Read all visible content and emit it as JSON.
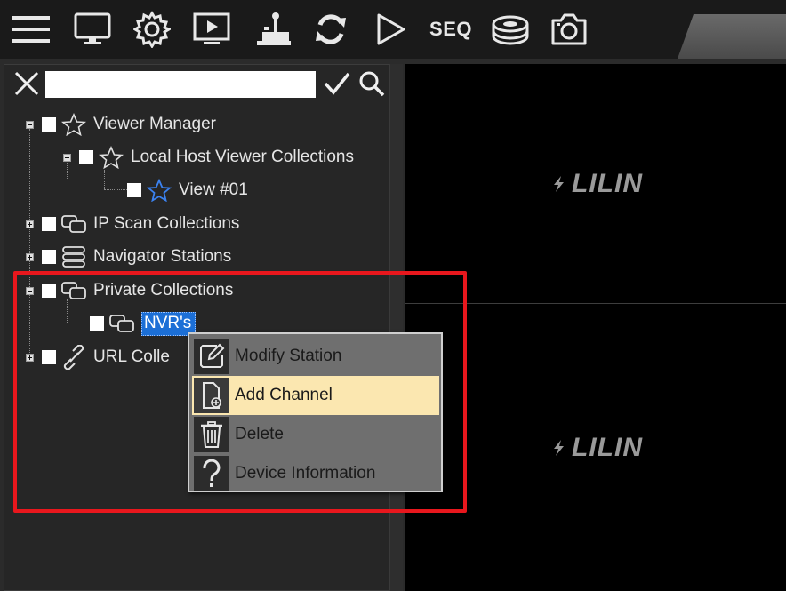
{
  "toolbar": {
    "buttons": [
      {
        "id": "menu",
        "icon": "hamburger-menu-icon"
      },
      {
        "id": "monitor",
        "icon": "monitor-icon"
      },
      {
        "id": "settings",
        "icon": "gear-icon"
      },
      {
        "id": "playback",
        "icon": "playback-screen-icon"
      },
      {
        "id": "joystick",
        "icon": "joystick-icon"
      },
      {
        "id": "refresh",
        "icon": "refresh-icon"
      },
      {
        "id": "play",
        "icon": "play-icon"
      },
      {
        "id": "seq",
        "label": "SEQ"
      },
      {
        "id": "storage",
        "icon": "disk-stack-icon"
      },
      {
        "id": "snapshot",
        "icon": "camera-icon"
      }
    ]
  },
  "search": {
    "value": "",
    "placeholder": ""
  },
  "tree": {
    "items": [
      {
        "label": "Viewer Manager",
        "icon": "star-icon",
        "expander": "minus"
      },
      {
        "label": "Local Host Viewer Collections",
        "icon": "star-icon",
        "expander": "minus"
      },
      {
        "label": "View #01",
        "icon": "star-blue-icon"
      },
      {
        "label": "IP Scan Collections",
        "icon": "collection-icon",
        "expander": "plus"
      },
      {
        "label": "Navigator Stations",
        "icon": "server-icon",
        "expander": "plus"
      },
      {
        "label": "Private Collections",
        "icon": "collection-icon",
        "expander": "minus"
      },
      {
        "label": "NVR's",
        "icon": "collection-icon",
        "selected": true
      },
      {
        "label": "URL Colle",
        "icon": "link-icon",
        "expander": "plus"
      }
    ]
  },
  "context_menu": {
    "items": [
      {
        "label": "Modify Station",
        "icon": "edit-icon"
      },
      {
        "label": "Add Channel",
        "icon": "add-channel-icon",
        "highlighted": true
      },
      {
        "label": "Delete",
        "icon": "trash-icon"
      },
      {
        "label": "Device Information",
        "icon": "question-icon"
      }
    ]
  },
  "video": {
    "cells": [
      {
        "logo_text": "LILIN"
      },
      {
        "logo_text": "LILIN"
      }
    ]
  },
  "colors": {
    "accent_highlight": "#e8171d",
    "selection": "#1c6fd6",
    "menu_hover": "#fbe7b0"
  }
}
